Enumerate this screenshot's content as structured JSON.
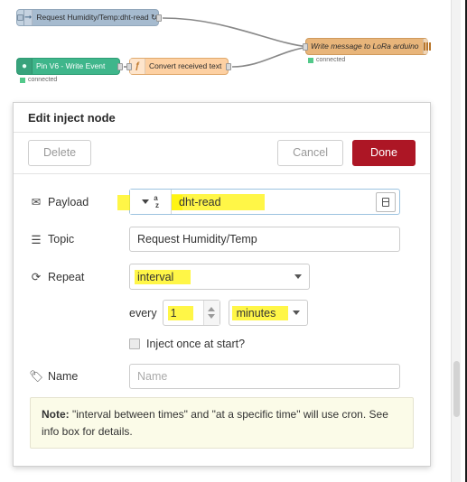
{
  "flow": {
    "nodes": [
      {
        "id": "inject",
        "label": "Request Humidity/Temp:dht-read ↻",
        "icon": "inject-arrow-icon",
        "color": "#a6bbcf"
      },
      {
        "id": "pin",
        "label": "Pin V6 - Write Event",
        "icon": "blynk-icon",
        "color": "#3fb68b",
        "status": "connected"
      },
      {
        "id": "func",
        "label": "Convert received text",
        "icon": "function-f-icon",
        "color": "#fdd0a2"
      },
      {
        "id": "lora",
        "label": "Write message to LoRa arduino",
        "icon": "serial-bars-icon",
        "color": "#e8b57a",
        "status": "connected"
      }
    ]
  },
  "dialog": {
    "title": "Edit inject node",
    "buttons": {
      "delete": "Delete",
      "cancel": "Cancel",
      "done": "Done"
    },
    "fields": {
      "payload": {
        "label": "Payload",
        "type_glyph_top": "a",
        "type_glyph_bottom": "z",
        "value": "dht-read"
      },
      "topic": {
        "label": "Topic",
        "value": "Request Humidity/Temp"
      },
      "repeat": {
        "label": "Repeat",
        "value": "interval",
        "every_label": "every",
        "count": "1",
        "units": "minutes",
        "once_label": "Inject once at start?"
      },
      "name": {
        "label": "Name",
        "placeholder": "Name",
        "value": ""
      }
    },
    "note": {
      "prefix": "Note:",
      "text": " \"interval between times\" and \"at a specific time\" will use cron. See info box for details."
    }
  },
  "colors": {
    "done_button": "#ad1625",
    "highlight": "#fff200",
    "note_background": "#fbfbe8",
    "inject_node": "#a6bbcf",
    "green_node": "#3fb68b",
    "function_node": "#fdd0a2",
    "serial_node": "#e8b57a"
  }
}
